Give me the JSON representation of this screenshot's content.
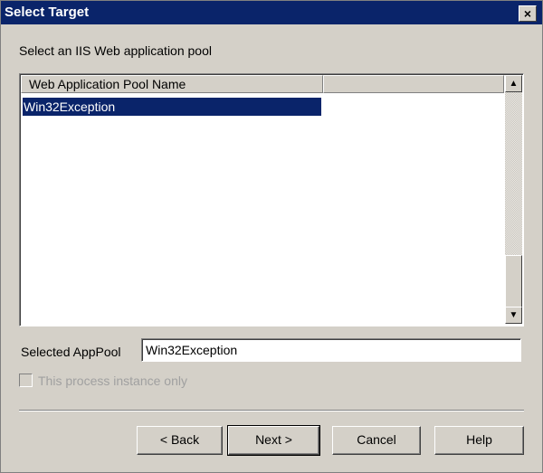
{
  "window": {
    "title": "Select Target"
  },
  "instruction": "Select an IIS Web application pool",
  "list": {
    "columns": [
      "Web Application Pool Name",
      ""
    ],
    "rows": [
      "Win32Exception"
    ],
    "selected_index": 0
  },
  "apppool": {
    "label": "Selected AppPool",
    "value": "Win32Exception"
  },
  "checkbox": {
    "label": "This process instance only",
    "checked": false,
    "enabled": false
  },
  "buttons": {
    "back": "< Back",
    "next": "Next >",
    "cancel": "Cancel",
    "help": "Help"
  },
  "icons": {
    "close": "×",
    "scroll_up": "▲",
    "scroll_down": "▼"
  },
  "colors": {
    "selection": "#0a246a",
    "dialog_bg": "#d4d0c8"
  }
}
